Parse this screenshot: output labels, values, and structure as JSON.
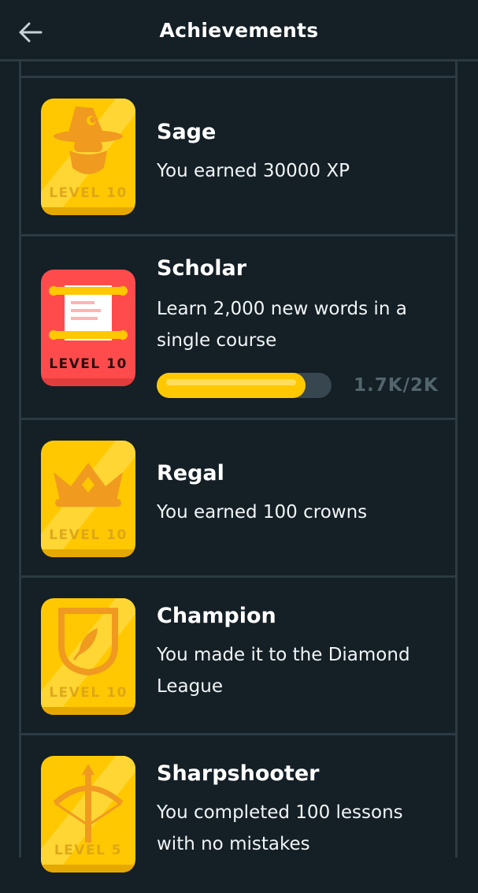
{
  "header": {
    "title": "Achievements",
    "back_icon": "arrow-left-icon"
  },
  "achievements": [
    {
      "title": "Sage",
      "description": "You earned 30000 XP",
      "level": "LEVEL 10",
      "icon": "wizard-icon",
      "color": "#ffc800"
    },
    {
      "title": "Scholar",
      "description": "Learn 2,000 new words in a single course",
      "level": "LEVEL 10",
      "icon": "scroll-icon",
      "color": "#ff4b4b",
      "progress": {
        "current": 1700,
        "goal": 2000,
        "fraction": 0.85,
        "label": "1.7K/2K"
      }
    },
    {
      "title": "Regal",
      "description": "You earned 100 crowns",
      "level": "LEVEL 10",
      "icon": "crown-icon",
      "color": "#ffc800"
    },
    {
      "title": "Champion",
      "description": "You made it to the Diamond League",
      "level": "LEVEL 10",
      "icon": "shield-feather-icon",
      "color": "#ffc800"
    },
    {
      "title": "Sharpshooter",
      "description": "You completed 100 lessons with no mistakes",
      "level": "LEVEL 5",
      "icon": "crossbow-icon",
      "color": "#ffc800"
    }
  ],
  "colors": {
    "background": "#141f26",
    "divider": "#2c3a42",
    "progress_fill": "#ffc800",
    "progress_track": "#37464f",
    "progress_text": "#52656d"
  }
}
